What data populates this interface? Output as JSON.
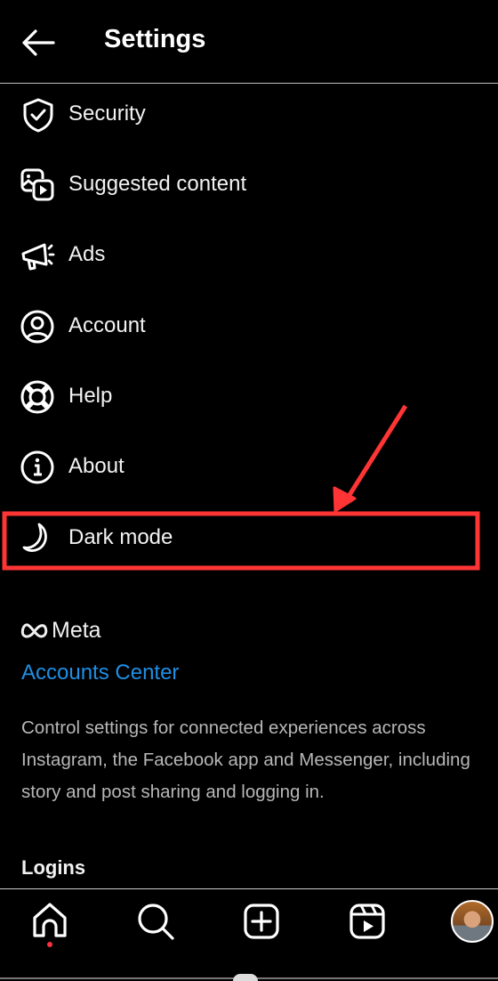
{
  "header": {
    "title": "Settings",
    "back_icon": "arrow-left-icon"
  },
  "settings_items": [
    {
      "label": "Security",
      "icon": "shield-check-icon"
    },
    {
      "label": "Suggested content",
      "icon": "suggested-content-icon"
    },
    {
      "label": "Ads",
      "icon": "megaphone-icon"
    },
    {
      "label": "Account",
      "icon": "user-circle-icon"
    },
    {
      "label": "Help",
      "icon": "lifebuoy-icon"
    },
    {
      "label": "About",
      "icon": "info-icon"
    },
    {
      "label": "Dark mode",
      "icon": "moon-icon"
    }
  ],
  "meta_section": {
    "brand": "Meta",
    "link": "Accounts Center",
    "description": "Control settings for connected experiences across Instagram, the Facebook app and Messenger, including story and post sharing and logging in.",
    "link_color": "#1f8fe5"
  },
  "logins_heading": "Logins",
  "bottom_nav": [
    {
      "name": "home",
      "icon": "home-icon",
      "active": true
    },
    {
      "name": "search",
      "icon": "search-icon"
    },
    {
      "name": "create",
      "icon": "plus-square-icon"
    },
    {
      "name": "reels",
      "icon": "reels-icon"
    },
    {
      "name": "profile",
      "icon": "avatar"
    }
  ],
  "annotation": {
    "highlight_target": "Dark mode",
    "color": "#ff3535"
  }
}
